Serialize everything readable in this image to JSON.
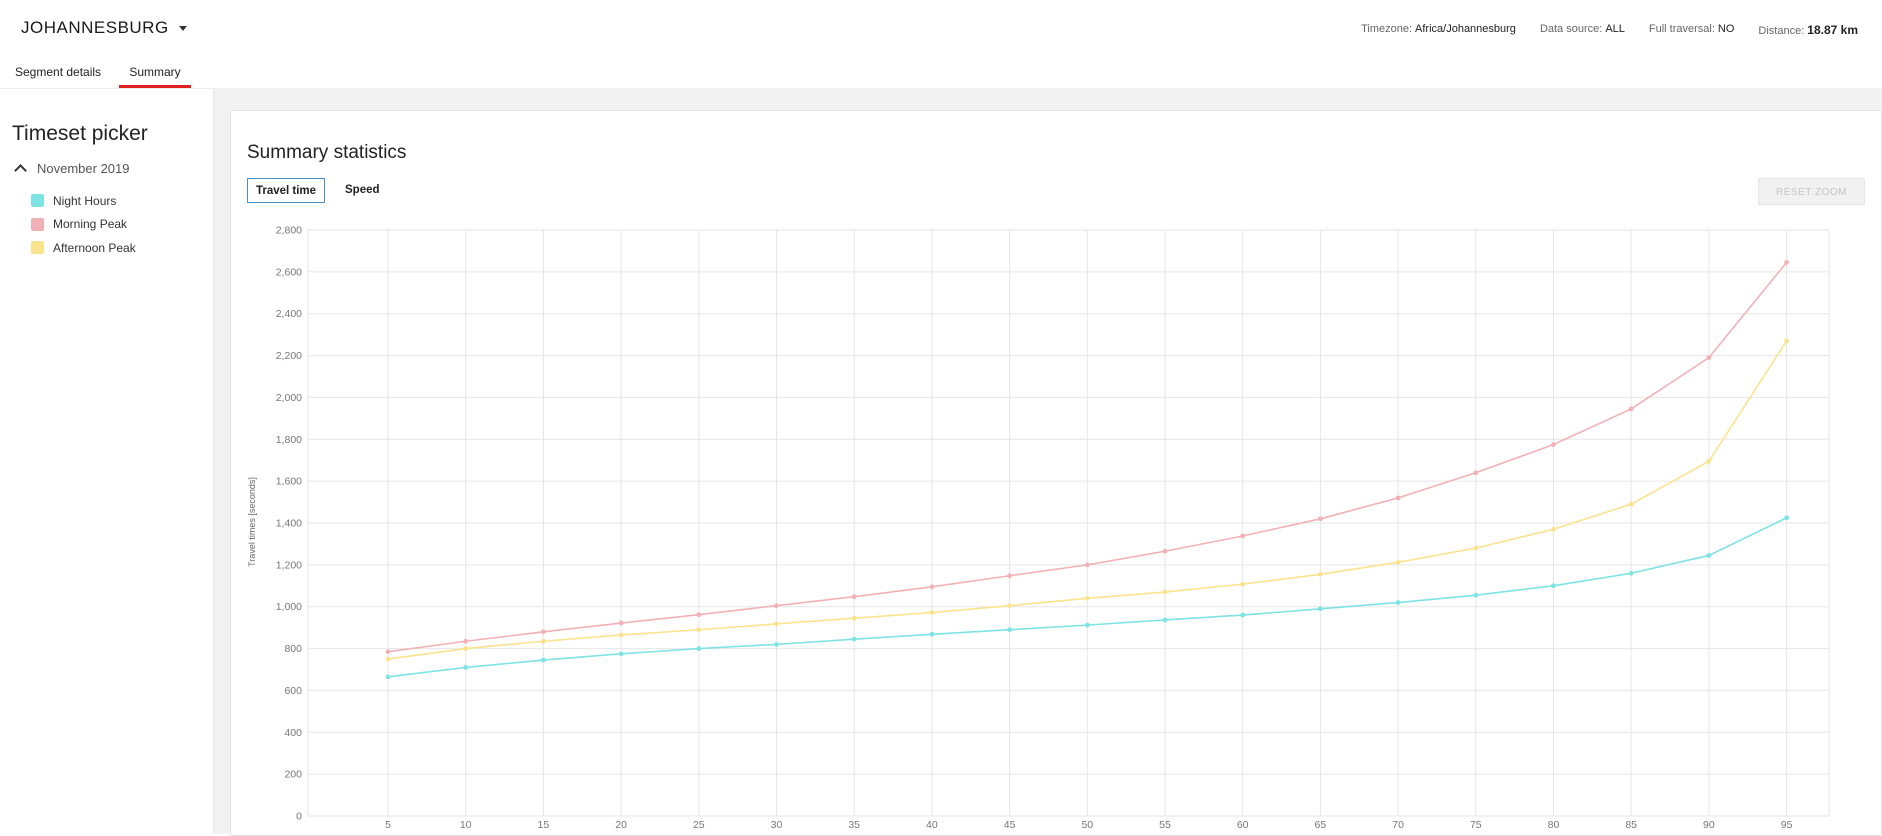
{
  "header": {
    "city": "JOHANNESBURG",
    "meta": [
      {
        "label": "Timezone:",
        "value": "Africa/Johannesburg",
        "bold": false
      },
      {
        "label": "Data source:",
        "value": "ALL",
        "bold": false
      },
      {
        "label": "Full traversal:",
        "value": "NO",
        "bold": false
      },
      {
        "label": "Distance:",
        "value": "18.87 km",
        "bold": true
      }
    ]
  },
  "tabs": {
    "segment_details": "Segment details",
    "summary": "Summary"
  },
  "sidebar": {
    "title": "Timeset picker",
    "month": "November 2019",
    "timesets": [
      {
        "label": "Night Hours",
        "color": "#7ee3e3"
      },
      {
        "label": "Morning Peak",
        "color": "#f2b1b6"
      },
      {
        "label": "Afternoon Peak",
        "color": "#fbe38e"
      }
    ]
  },
  "main": {
    "title": "Summary statistics",
    "toggle_travel_time": "Travel time",
    "toggle_speed": "Speed",
    "reset_zoom": "RESET ZOOM"
  },
  "chart_data": {
    "type": "line",
    "ylabel": "Travel times [seconds]",
    "xlabel": "",
    "ylim": [
      0,
      2800
    ],
    "yticks": [
      0,
      200,
      400,
      600,
      800,
      1000,
      1200,
      1400,
      1600,
      1800,
      2000,
      2200,
      2400,
      2600,
      2800
    ],
    "x": [
      5,
      10,
      15,
      20,
      25,
      30,
      35,
      40,
      45,
      50,
      55,
      60,
      65,
      70,
      75,
      80,
      85,
      90,
      95
    ],
    "grid": true,
    "series": [
      {
        "name": "Night Hours",
        "color": "#7ee3e3",
        "values": [
          665,
          710,
          745,
          775,
          800,
          820,
          845,
          868,
          890,
          912,
          937,
          960,
          990,
          1020,
          1055,
          1100,
          1160,
          1245,
          1425
        ]
      },
      {
        "name": "Morning Peak",
        "color": "#f2b1b6",
        "values": [
          785,
          835,
          880,
          922,
          962,
          1005,
          1048,
          1095,
          1148,
          1200,
          1265,
          1338,
          1420,
          1520,
          1640,
          1775,
          1945,
          2190,
          2645
        ]
      },
      {
        "name": "Afternoon Peak",
        "color": "#fbe38e",
        "values": [
          750,
          800,
          835,
          865,
          890,
          918,
          945,
          972,
          1005,
          1040,
          1070,
          1108,
          1155,
          1212,
          1280,
          1370,
          1490,
          1695,
          2270
        ]
      }
    ]
  }
}
